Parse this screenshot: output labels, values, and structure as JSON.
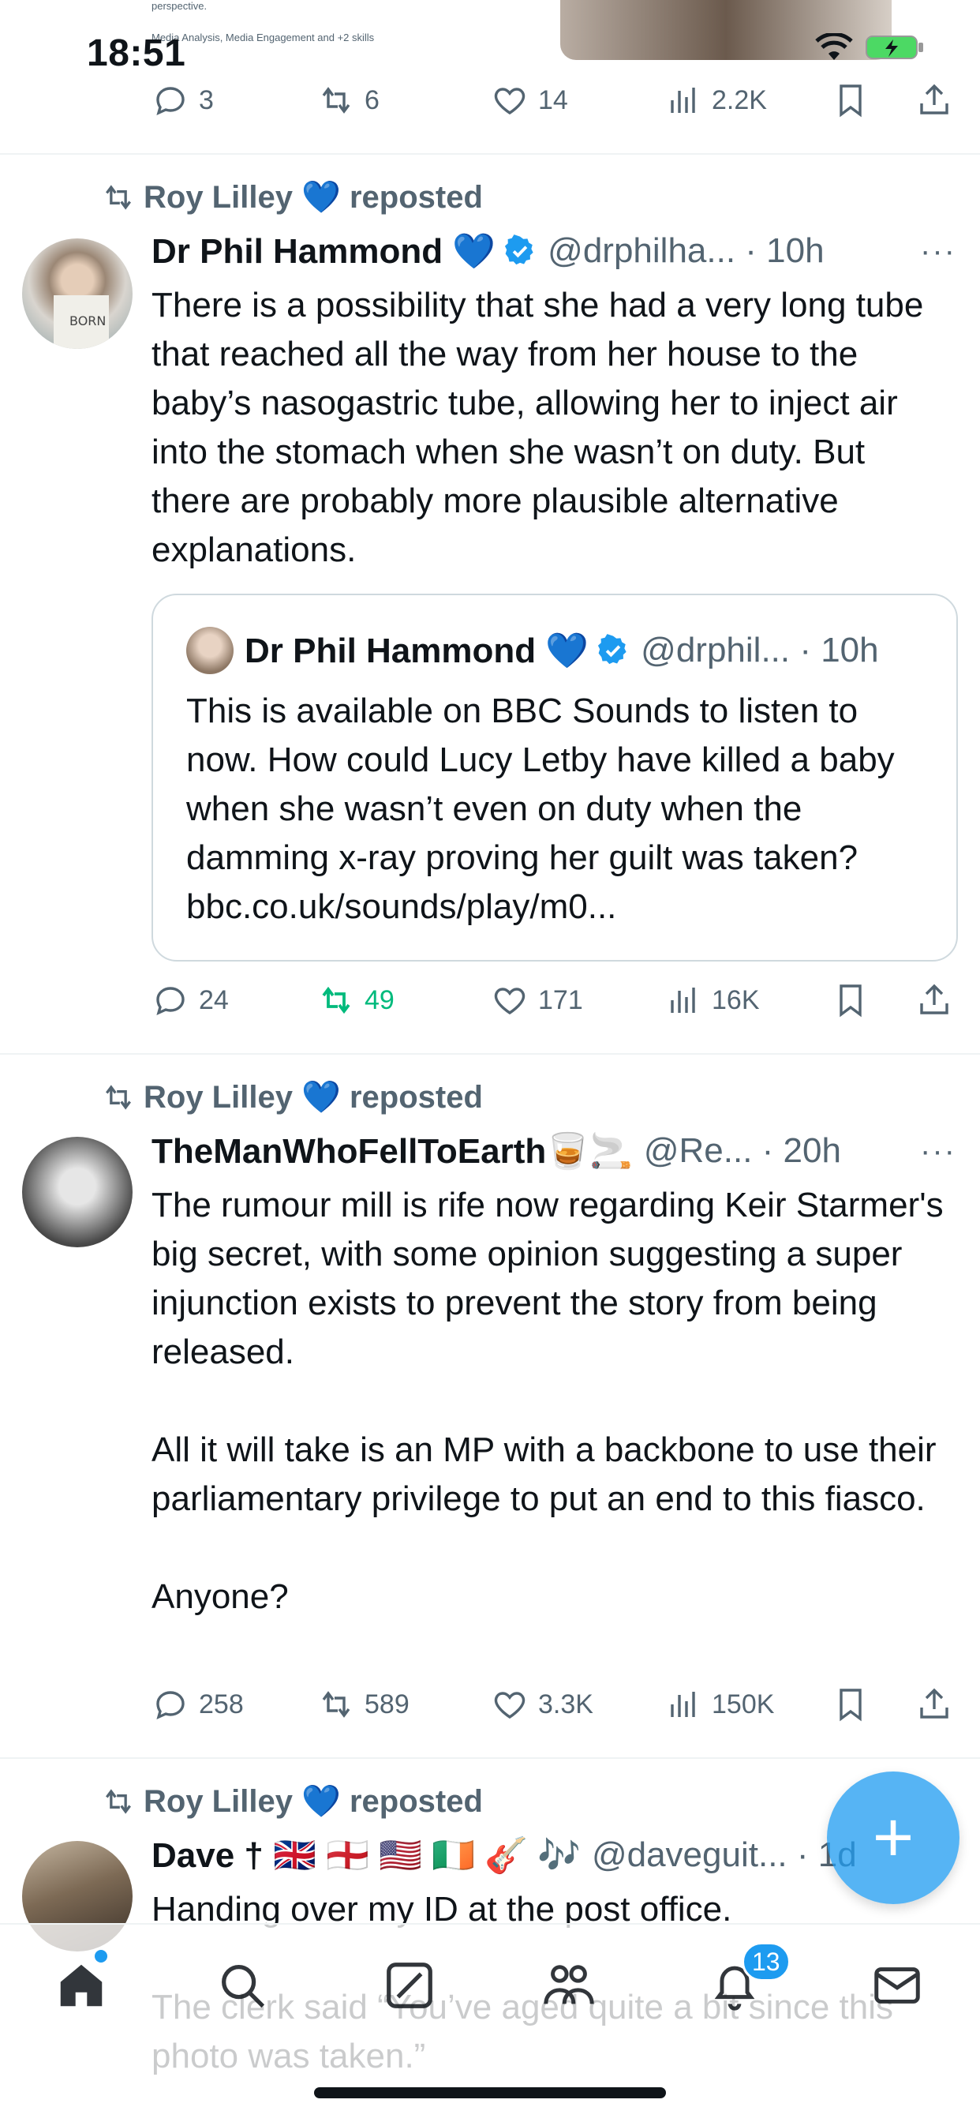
{
  "status_bar": {
    "time": "18:51"
  },
  "peek": {
    "line1": "perspective.",
    "line2": "Media Analysis, Media Engagement and +2 skills",
    "actions": {
      "replies": "3",
      "reposts": "6",
      "likes": "14",
      "views": "2.2K"
    }
  },
  "tweets": [
    {
      "repost_label": "Roy Lilley 💙 reposted",
      "name": "Dr Phil Hammond 💙",
      "handle": "@drphilha... · 10h",
      "text": "There is a possibility that she had a very long tube that reached all the way from her house to the baby’s nasogastric tube, allowing her to inject air into the stomach when she wasn’t on duty. But there are probably more plausible alternative explanations.",
      "quote": {
        "name": "Dr Phil Hammond 💙",
        "handle": "@drphil... · 10h",
        "text": "This is available on BBC Sounds to listen to now. How could Lucy Letby have killed a baby when she wasn’t even on duty when the damming x-ray proving her guilt was taken?  bbc.co.uk/sounds/play/m0..."
      },
      "actions": {
        "replies": "24",
        "reposts": "49",
        "likes": "171",
        "views": "16K"
      },
      "reposted_by_me": true
    },
    {
      "repost_label": "Roy Lilley 💙 reposted",
      "name": "TheManWhoFellToEarth🥃🚬",
      "handle": "@Re... · 20h",
      "text": "The rumour mill is rife now regarding Keir Starmer's big secret, with some opinion suggesting a super injunction exists to prevent the story from being released.\n\nAll it will take is an MP with a backbone to use their parliamentary privilege to put an end to this fiasco.\n\nAnyone?",
      "actions": {
        "replies": "258",
        "reposts": "589",
        "likes": "3.3K",
        "views": "150K"
      }
    },
    {
      "repost_label": "Roy Lilley 💙 reposted",
      "name": "Dave † 🇬🇧 🏴󠁧󠁢󠁥󠁮󠁧󠁿 🇺🇸 🇮🇪 🎸 🎶",
      "handle": "@daveguit... · 1d",
      "text": "Handing over my ID at the post office.\n\nThe clerk said “You’ve aged quite a bit since this photo was taken.”"
    }
  ],
  "bottom_nav": {
    "notifications_badge": "13"
  },
  "colors": {
    "accent": "#1d9bf0",
    "repost_green": "#00ba7c",
    "muted": "#536471"
  }
}
